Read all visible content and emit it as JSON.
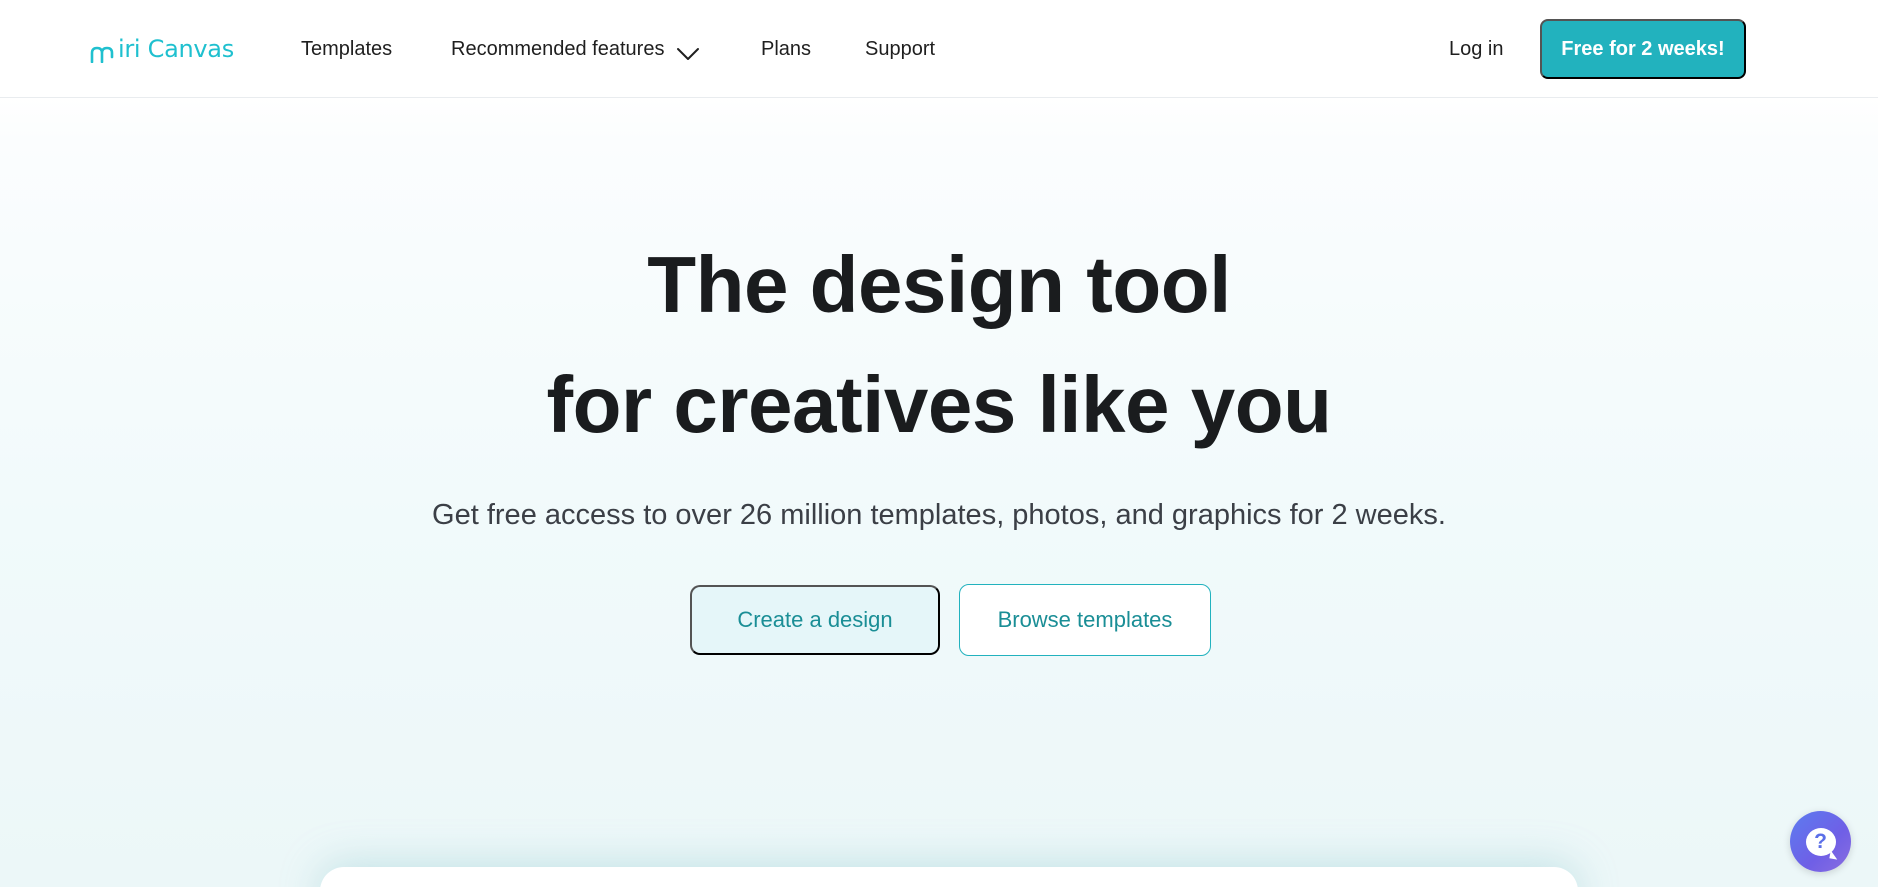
{
  "brand": {
    "logo_text": "iri Canvas",
    "accent_color": "#22b2be",
    "logo_color": "#1fc0cf"
  },
  "nav": {
    "templates": "Templates",
    "recommended_features": "Recommended features",
    "plans": "Plans",
    "support": "Support",
    "login": "Log in",
    "cta": "Free for 2 weeks!"
  },
  "hero": {
    "title_line1": "The design tool",
    "title_line2": "for creatives like you",
    "subtitle": "Get free access to over 26 million templates, photos, and graphics for 2 weeks.",
    "primary_button": "Create a design",
    "secondary_button": "Browse templates"
  },
  "help": {
    "icon": "question-chat-icon",
    "glyph": "?"
  }
}
